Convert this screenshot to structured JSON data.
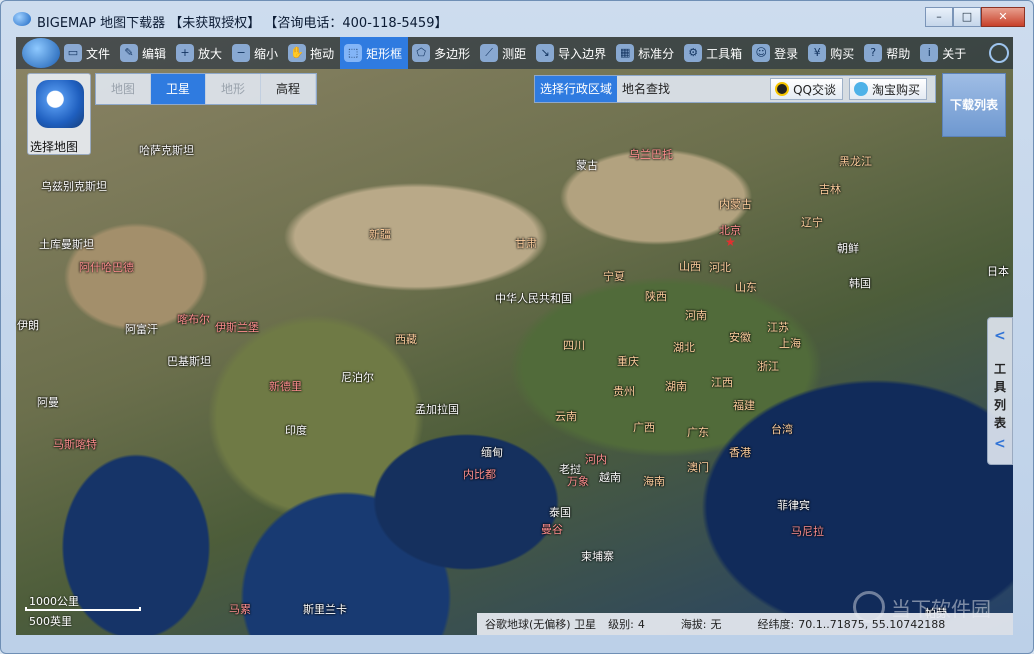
{
  "window": {
    "title": "BIGEMAP 地图下载器 【未获取授权】 【咨询电话：400-118-5459】",
    "minimize_glyph": "–",
    "maximize_glyph": "□",
    "close_glyph": "✕"
  },
  "toolbar": {
    "items": [
      {
        "label": "文件",
        "icon": "folder-icon"
      },
      {
        "label": "编辑",
        "icon": "edit-icon"
      },
      {
        "label": "放大",
        "icon": "zoom-in-icon"
      },
      {
        "label": "缩小",
        "icon": "zoom-out-icon"
      },
      {
        "label": "拖动",
        "icon": "hand-icon"
      },
      {
        "label": "矩形框",
        "icon": "rectangle-select-icon",
        "active": true
      },
      {
        "label": "多边形",
        "icon": "polygon-icon"
      },
      {
        "label": "测距",
        "icon": "ruler-icon"
      },
      {
        "label": "导入边界",
        "icon": "import-boundary-icon"
      },
      {
        "label": "标准分",
        "icon": "grid-icon"
      },
      {
        "label": "工具箱",
        "icon": "toolbox-icon"
      },
      {
        "label": "登录",
        "icon": "user-icon"
      },
      {
        "label": "购买",
        "icon": "cart-icon"
      },
      {
        "label": "帮助",
        "icon": "help-icon"
      },
      {
        "label": "关于",
        "icon": "info-icon"
      }
    ]
  },
  "map_select": {
    "label": "选择地图"
  },
  "map_types": [
    {
      "label": "地图",
      "state": "disabled"
    },
    {
      "label": "卫星",
      "state": "active"
    },
    {
      "label": "地形",
      "state": "disabled"
    },
    {
      "label": "高程",
      "state": "enabled"
    }
  ],
  "search": {
    "tab_admin": "选择行政区域",
    "tab_place": "地名查找",
    "qq_button": "QQ交谈",
    "taobao_button": "淘宝购买"
  },
  "download_list": {
    "label": "下载列表"
  },
  "tool_list": {
    "label": "工具列表",
    "arrow_glyph": "<"
  },
  "places": [
    {
      "name": "哈萨克斯坦",
      "style": "w"
    },
    {
      "name": "乌兹别克斯坦",
      "style": "w"
    },
    {
      "name": "土库曼斯坦",
      "style": "w"
    },
    {
      "name": "阿什哈巴德",
      "style": "r"
    },
    {
      "name": "蒙古",
      "style": "w"
    },
    {
      "name": "乌兰巴托",
      "style": "r"
    },
    {
      "name": "黑龙江",
      "style": "o"
    },
    {
      "name": "吉林",
      "style": "o"
    },
    {
      "name": "辽宁",
      "style": "o"
    },
    {
      "name": "内蒙古",
      "style": "o"
    },
    {
      "name": "北京",
      "style": "r"
    },
    {
      "name": "朝鲜",
      "style": "w"
    },
    {
      "name": "韩国",
      "style": "w"
    },
    {
      "name": "日本",
      "style": "w"
    },
    {
      "name": "新疆",
      "style": "o"
    },
    {
      "name": "甘肃",
      "style": "o"
    },
    {
      "name": "宁夏",
      "style": "o"
    },
    {
      "name": "山西",
      "style": "o"
    },
    {
      "name": "河北",
      "style": "o"
    },
    {
      "name": "山东",
      "style": "o"
    },
    {
      "name": "陕西",
      "style": "o"
    },
    {
      "name": "河南",
      "style": "o"
    },
    {
      "name": "江苏",
      "style": "o"
    },
    {
      "name": "安徽",
      "style": "o"
    },
    {
      "name": "上海",
      "style": "o"
    },
    {
      "name": "中华人民共和国",
      "style": "w"
    },
    {
      "name": "伊朗",
      "style": "w"
    },
    {
      "name": "阿富汗",
      "style": "w"
    },
    {
      "name": "喀布尔",
      "style": "r"
    },
    {
      "name": "伊斯兰堡",
      "style": "r"
    },
    {
      "name": "巴基斯坦",
      "style": "w"
    },
    {
      "name": "西藏",
      "style": "o"
    },
    {
      "name": "四川",
      "style": "o"
    },
    {
      "name": "湖北",
      "style": "o"
    },
    {
      "name": "浙江",
      "style": "o"
    },
    {
      "name": "重庆",
      "style": "o"
    },
    {
      "name": "新德里",
      "style": "r"
    },
    {
      "name": "尼泊尔",
      "style": "w"
    },
    {
      "name": "贵州",
      "style": "o"
    },
    {
      "name": "湖南",
      "style": "o"
    },
    {
      "name": "江西",
      "style": "o"
    },
    {
      "name": "福建",
      "style": "o"
    },
    {
      "name": "阿曼",
      "style": "w"
    },
    {
      "name": "印度",
      "style": "w"
    },
    {
      "name": "孟加拉国",
      "style": "w"
    },
    {
      "name": "云南",
      "style": "o"
    },
    {
      "name": "广西",
      "style": "o"
    },
    {
      "name": "广东",
      "style": "o"
    },
    {
      "name": "台湾",
      "style": "o"
    },
    {
      "name": "马斯喀特",
      "style": "r"
    },
    {
      "name": "缅甸",
      "style": "w"
    },
    {
      "name": "河内",
      "style": "r"
    },
    {
      "name": "香港",
      "style": "o"
    },
    {
      "name": "澳门",
      "style": "o"
    },
    {
      "name": "海南",
      "style": "o"
    },
    {
      "name": "内比都",
      "style": "r"
    },
    {
      "name": "老挝",
      "style": "w"
    },
    {
      "name": "越南",
      "style": "w"
    },
    {
      "name": "万象",
      "style": "r"
    },
    {
      "name": "菲律宾",
      "style": "w"
    },
    {
      "name": "泰国",
      "style": "w"
    },
    {
      "name": "曼谷",
      "style": "r"
    },
    {
      "name": "柬埔寨",
      "style": "w"
    },
    {
      "name": "马尼拉",
      "style": "r"
    },
    {
      "name": "马累",
      "style": "r"
    },
    {
      "name": "斯里兰卡",
      "style": "w"
    },
    {
      "name": "帕劳",
      "style": "w"
    }
  ],
  "scale": {
    "metric": "1000公里",
    "imperial": "500英里"
  },
  "status": {
    "source": "谷歌地球(无偏移) 卫星",
    "level_label": "级别:",
    "level_value": "4",
    "altitude_label": "海拔:",
    "altitude_value": "无",
    "coord_label": "经纬度:",
    "coord_value": "70.1..71875, 55.10742188"
  },
  "watermark": {
    "text": "当下软件园"
  }
}
